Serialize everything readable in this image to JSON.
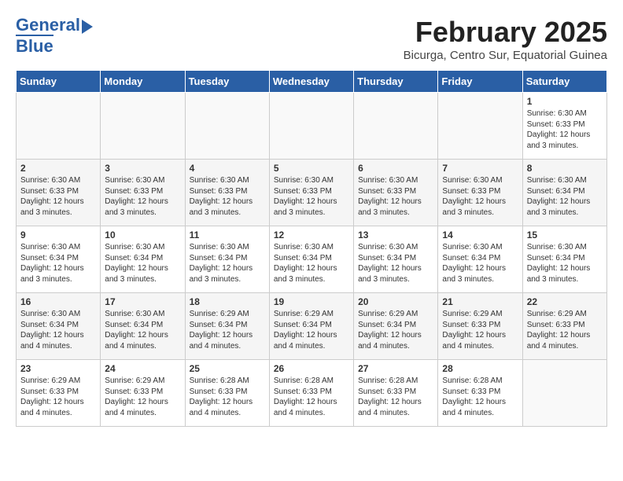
{
  "header": {
    "logo_line1": "General",
    "logo_line2": "Blue",
    "month": "February 2025",
    "location": "Bicurga, Centro Sur, Equatorial Guinea"
  },
  "weekdays": [
    "Sunday",
    "Monday",
    "Tuesday",
    "Wednesday",
    "Thursday",
    "Friday",
    "Saturday"
  ],
  "weeks": [
    [
      {
        "day": "",
        "content": ""
      },
      {
        "day": "",
        "content": ""
      },
      {
        "day": "",
        "content": ""
      },
      {
        "day": "",
        "content": ""
      },
      {
        "day": "",
        "content": ""
      },
      {
        "day": "",
        "content": ""
      },
      {
        "day": "1",
        "content": "Sunrise: 6:30 AM\nSunset: 6:33 PM\nDaylight: 12 hours\nand 3 minutes."
      }
    ],
    [
      {
        "day": "2",
        "content": "Sunrise: 6:30 AM\nSunset: 6:33 PM\nDaylight: 12 hours\nand 3 minutes."
      },
      {
        "day": "3",
        "content": "Sunrise: 6:30 AM\nSunset: 6:33 PM\nDaylight: 12 hours\nand 3 minutes."
      },
      {
        "day": "4",
        "content": "Sunrise: 6:30 AM\nSunset: 6:33 PM\nDaylight: 12 hours\nand 3 minutes."
      },
      {
        "day": "5",
        "content": "Sunrise: 6:30 AM\nSunset: 6:33 PM\nDaylight: 12 hours\nand 3 minutes."
      },
      {
        "day": "6",
        "content": "Sunrise: 6:30 AM\nSunset: 6:33 PM\nDaylight: 12 hours\nand 3 minutes."
      },
      {
        "day": "7",
        "content": "Sunrise: 6:30 AM\nSunset: 6:33 PM\nDaylight: 12 hours\nand 3 minutes."
      },
      {
        "day": "8",
        "content": "Sunrise: 6:30 AM\nSunset: 6:34 PM\nDaylight: 12 hours\nand 3 minutes."
      }
    ],
    [
      {
        "day": "9",
        "content": "Sunrise: 6:30 AM\nSunset: 6:34 PM\nDaylight: 12 hours\nand 3 minutes."
      },
      {
        "day": "10",
        "content": "Sunrise: 6:30 AM\nSunset: 6:34 PM\nDaylight: 12 hours\nand 3 minutes."
      },
      {
        "day": "11",
        "content": "Sunrise: 6:30 AM\nSunset: 6:34 PM\nDaylight: 12 hours\nand 3 minutes."
      },
      {
        "day": "12",
        "content": "Sunrise: 6:30 AM\nSunset: 6:34 PM\nDaylight: 12 hours\nand 3 minutes."
      },
      {
        "day": "13",
        "content": "Sunrise: 6:30 AM\nSunset: 6:34 PM\nDaylight: 12 hours\nand 3 minutes."
      },
      {
        "day": "14",
        "content": "Sunrise: 6:30 AM\nSunset: 6:34 PM\nDaylight: 12 hours\nand 3 minutes."
      },
      {
        "day": "15",
        "content": "Sunrise: 6:30 AM\nSunset: 6:34 PM\nDaylight: 12 hours\nand 3 minutes."
      }
    ],
    [
      {
        "day": "16",
        "content": "Sunrise: 6:30 AM\nSunset: 6:34 PM\nDaylight: 12 hours\nand 4 minutes."
      },
      {
        "day": "17",
        "content": "Sunrise: 6:30 AM\nSunset: 6:34 PM\nDaylight: 12 hours\nand 4 minutes."
      },
      {
        "day": "18",
        "content": "Sunrise: 6:29 AM\nSunset: 6:34 PM\nDaylight: 12 hours\nand 4 minutes."
      },
      {
        "day": "19",
        "content": "Sunrise: 6:29 AM\nSunset: 6:34 PM\nDaylight: 12 hours\nand 4 minutes."
      },
      {
        "day": "20",
        "content": "Sunrise: 6:29 AM\nSunset: 6:34 PM\nDaylight: 12 hours\nand 4 minutes."
      },
      {
        "day": "21",
        "content": "Sunrise: 6:29 AM\nSunset: 6:33 PM\nDaylight: 12 hours\nand 4 minutes."
      },
      {
        "day": "22",
        "content": "Sunrise: 6:29 AM\nSunset: 6:33 PM\nDaylight: 12 hours\nand 4 minutes."
      }
    ],
    [
      {
        "day": "23",
        "content": "Sunrise: 6:29 AM\nSunset: 6:33 PM\nDaylight: 12 hours\nand 4 minutes."
      },
      {
        "day": "24",
        "content": "Sunrise: 6:29 AM\nSunset: 6:33 PM\nDaylight: 12 hours\nand 4 minutes."
      },
      {
        "day": "25",
        "content": "Sunrise: 6:28 AM\nSunset: 6:33 PM\nDaylight: 12 hours\nand 4 minutes."
      },
      {
        "day": "26",
        "content": "Sunrise: 6:28 AM\nSunset: 6:33 PM\nDaylight: 12 hours\nand 4 minutes."
      },
      {
        "day": "27",
        "content": "Sunrise: 6:28 AM\nSunset: 6:33 PM\nDaylight: 12 hours\nand 4 minutes."
      },
      {
        "day": "28",
        "content": "Sunrise: 6:28 AM\nSunset: 6:33 PM\nDaylight: 12 hours\nand 4 minutes."
      },
      {
        "day": "",
        "content": ""
      }
    ]
  ]
}
